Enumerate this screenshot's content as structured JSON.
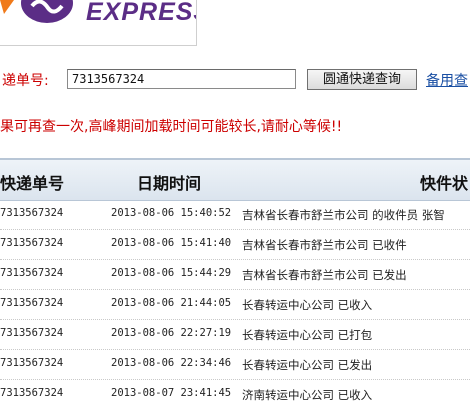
{
  "logo": {
    "text": "EXPRESS"
  },
  "query": {
    "label": "递单号:",
    "tracking_value": "7313567324",
    "search_button": "圆通快递查询",
    "backup_link": "备用查"
  },
  "notice": "果可再查一次,高峰期间加载时间可能较长,请耐心等候!!",
  "table": {
    "headers": [
      "快递单号",
      "日期时间",
      "快件状"
    ],
    "rows": [
      {
        "no": "7313567324",
        "date": "2013-08-06 15:40:52",
        "status": "吉林省长春市舒兰市公司 的收件员 张智"
      },
      {
        "no": "7313567324",
        "date": "2013-08-06 15:41:40",
        "status": "吉林省长春市舒兰市公司 已收件"
      },
      {
        "no": "7313567324",
        "date": "2013-08-06 15:44:29",
        "status": "吉林省长春市舒兰市公司 已发出"
      },
      {
        "no": "7313567324",
        "date": "2013-08-06 21:44:05",
        "status": "长春转运中心公司 已收入"
      },
      {
        "no": "7313567324",
        "date": "2013-08-06 22:27:19",
        "status": "长春转运中心公司 已打包"
      },
      {
        "no": "7313567324",
        "date": "2013-08-06 22:34:46",
        "status": "长春转运中心公司 已发出"
      },
      {
        "no": "7313567324",
        "date": "2013-08-07 23:41:45",
        "status": "济南转运中心公司 已收入"
      }
    ]
  },
  "colors": {
    "brand": "#5b2d86",
    "warning": "#cc0000",
    "link": "#1a4fa3",
    "header_bg": "#dbe4ee"
  }
}
